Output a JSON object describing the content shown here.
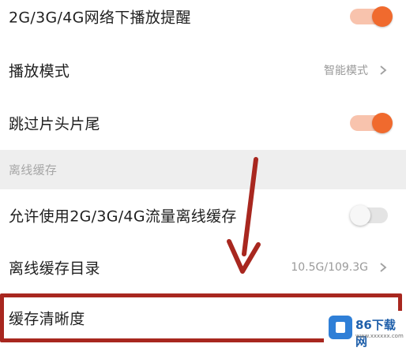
{
  "settings": {
    "row1": {
      "label": "2G/3G/4G网络下播放提醒",
      "toggle": "on"
    },
    "row2": {
      "label": "播放模式",
      "value": "智能模式"
    },
    "row3": {
      "label": "跳过片头片尾",
      "toggle": "on"
    },
    "section": {
      "label": "离线缓存"
    },
    "row4": {
      "label": "允许使用2G/3G/4G流量离线缓存",
      "toggle": "off"
    },
    "row5": {
      "label": "离线缓存目录",
      "value": "10.5G/109.3G"
    },
    "row6": {
      "label": "缓存清晰度"
    }
  },
  "colors": {
    "accent": "#f06a2e",
    "annotation": "#a8271f"
  },
  "watermark": {
    "title": "86下载网",
    "subtitle": "www.xxxxxx.com"
  }
}
